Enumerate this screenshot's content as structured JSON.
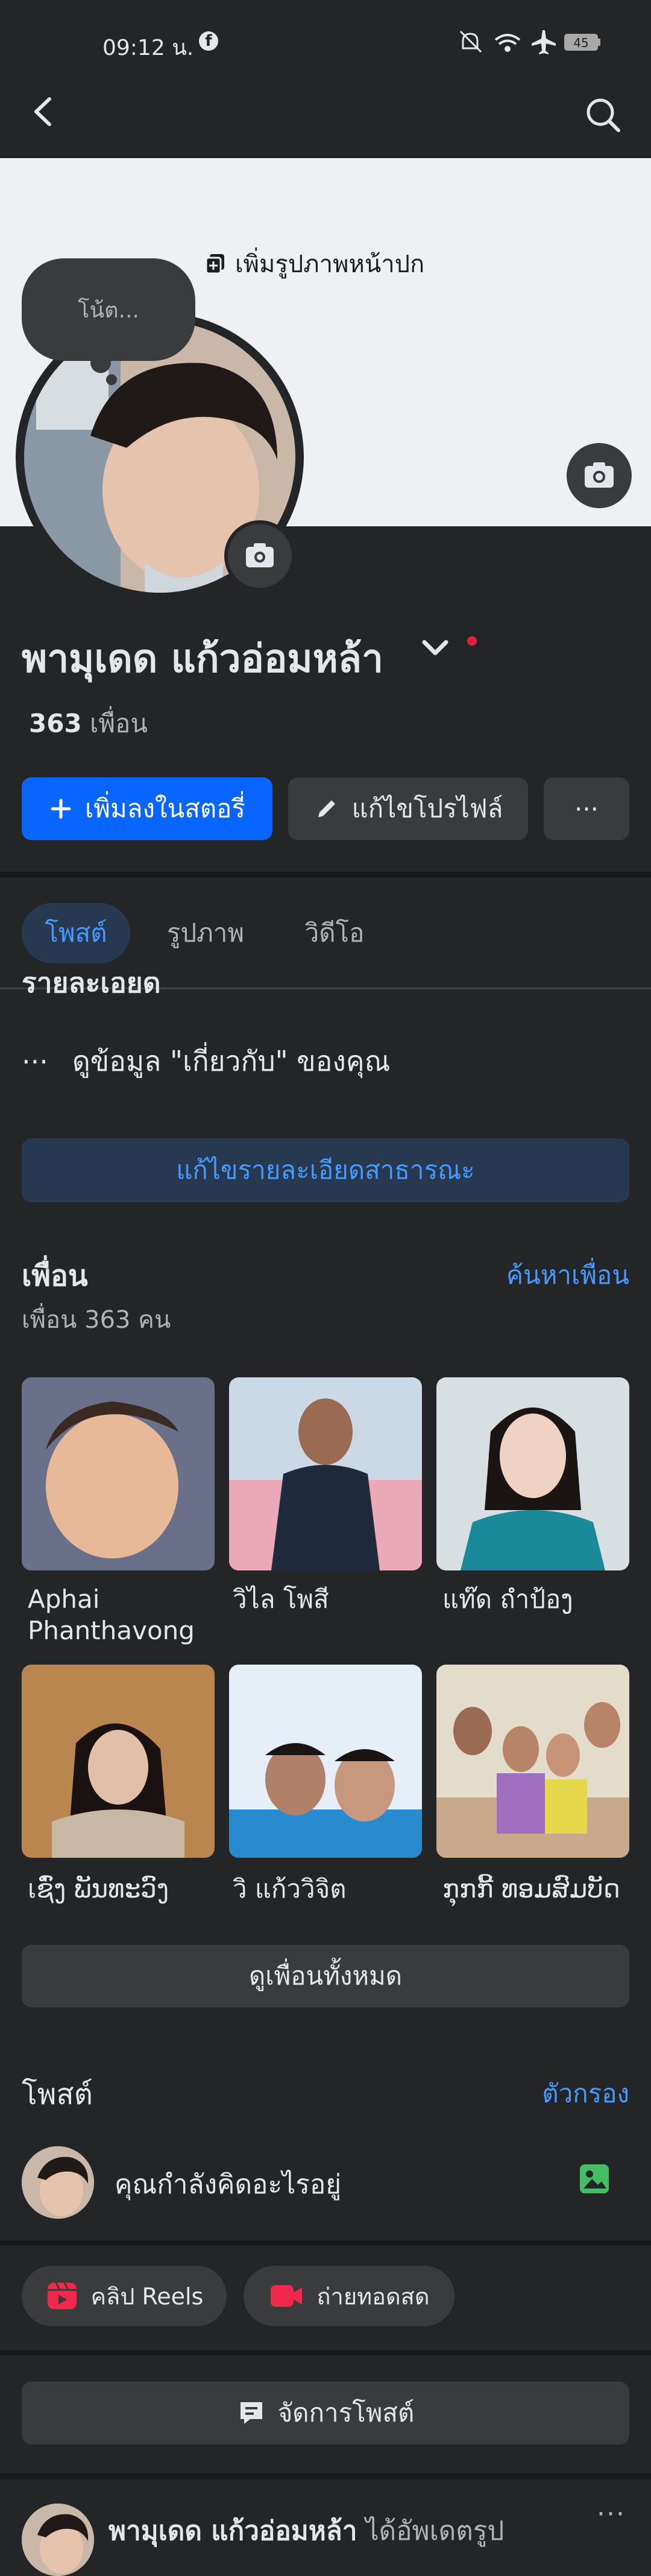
{
  "status_bar": {
    "time": "09:12 น.",
    "battery": "45",
    "fb_badge": "f"
  },
  "cover": {
    "add_cover_label": "เพิ่มรูปภาพหน้าปก"
  },
  "note": {
    "placeholder": "โน้ต..."
  },
  "profile": {
    "name": "พามุเดด แก้วอ่อมหล้า",
    "friends_count": "363",
    "friends_suffix": "เพื่อน"
  },
  "actions": {
    "add_story": "เพิ่มลงในสตอรี่",
    "edit_profile": "แก้ไขโปรไฟล์",
    "more": "···"
  },
  "tabs": [
    {
      "label": "โพสต์"
    },
    {
      "label": "รูปภาพ"
    },
    {
      "label": "วิดีโอ"
    }
  ],
  "details": {
    "cut_heading": "รายละเอียด",
    "dots": "···",
    "about_label": "ดูข้อมูล \"เกี่ยวกับ\" ของคุณ",
    "edit_public": "แก้ไขรายละเอียดสาธารณะ"
  },
  "friends": {
    "title": "เพื่อน",
    "find": "ค้นหาเพื่อน",
    "count": "เพื่อน 363 คน",
    "items": [
      {
        "name": "Aphai Phanthavong"
      },
      {
        "name": "วิไล โพสี"
      },
      {
        "name": "แท๊ด ถำป้อງ"
      },
      {
        "name": "เຊົ່ງ ພັນທະວົງ"
      },
      {
        "name": "วิ แก้ววิจิต"
      },
      {
        "name": "ກຸກກີ້ ທອມສົມບັດ"
      }
    ],
    "see_all": "ดูเพื่อนทั้งหมด"
  },
  "posts": {
    "title": "โพสต์",
    "filter": "ตัวกรอง",
    "composer": "คุณกำลังคิดอะไรอยู่",
    "reels": "คลิป Reels",
    "live": "ถ่ายทอดสด",
    "manage": "จัดการโพสต์",
    "first_post_name": "พามุเดด แก้วอ่อมหล้า",
    "first_post_action": " ได้อัพเดตรูป",
    "first_post_more": "···"
  },
  "colors": {
    "accent": "#0866ff",
    "link": "#4599ff",
    "bg": "#242526",
    "chip": "#3a3b3c"
  }
}
